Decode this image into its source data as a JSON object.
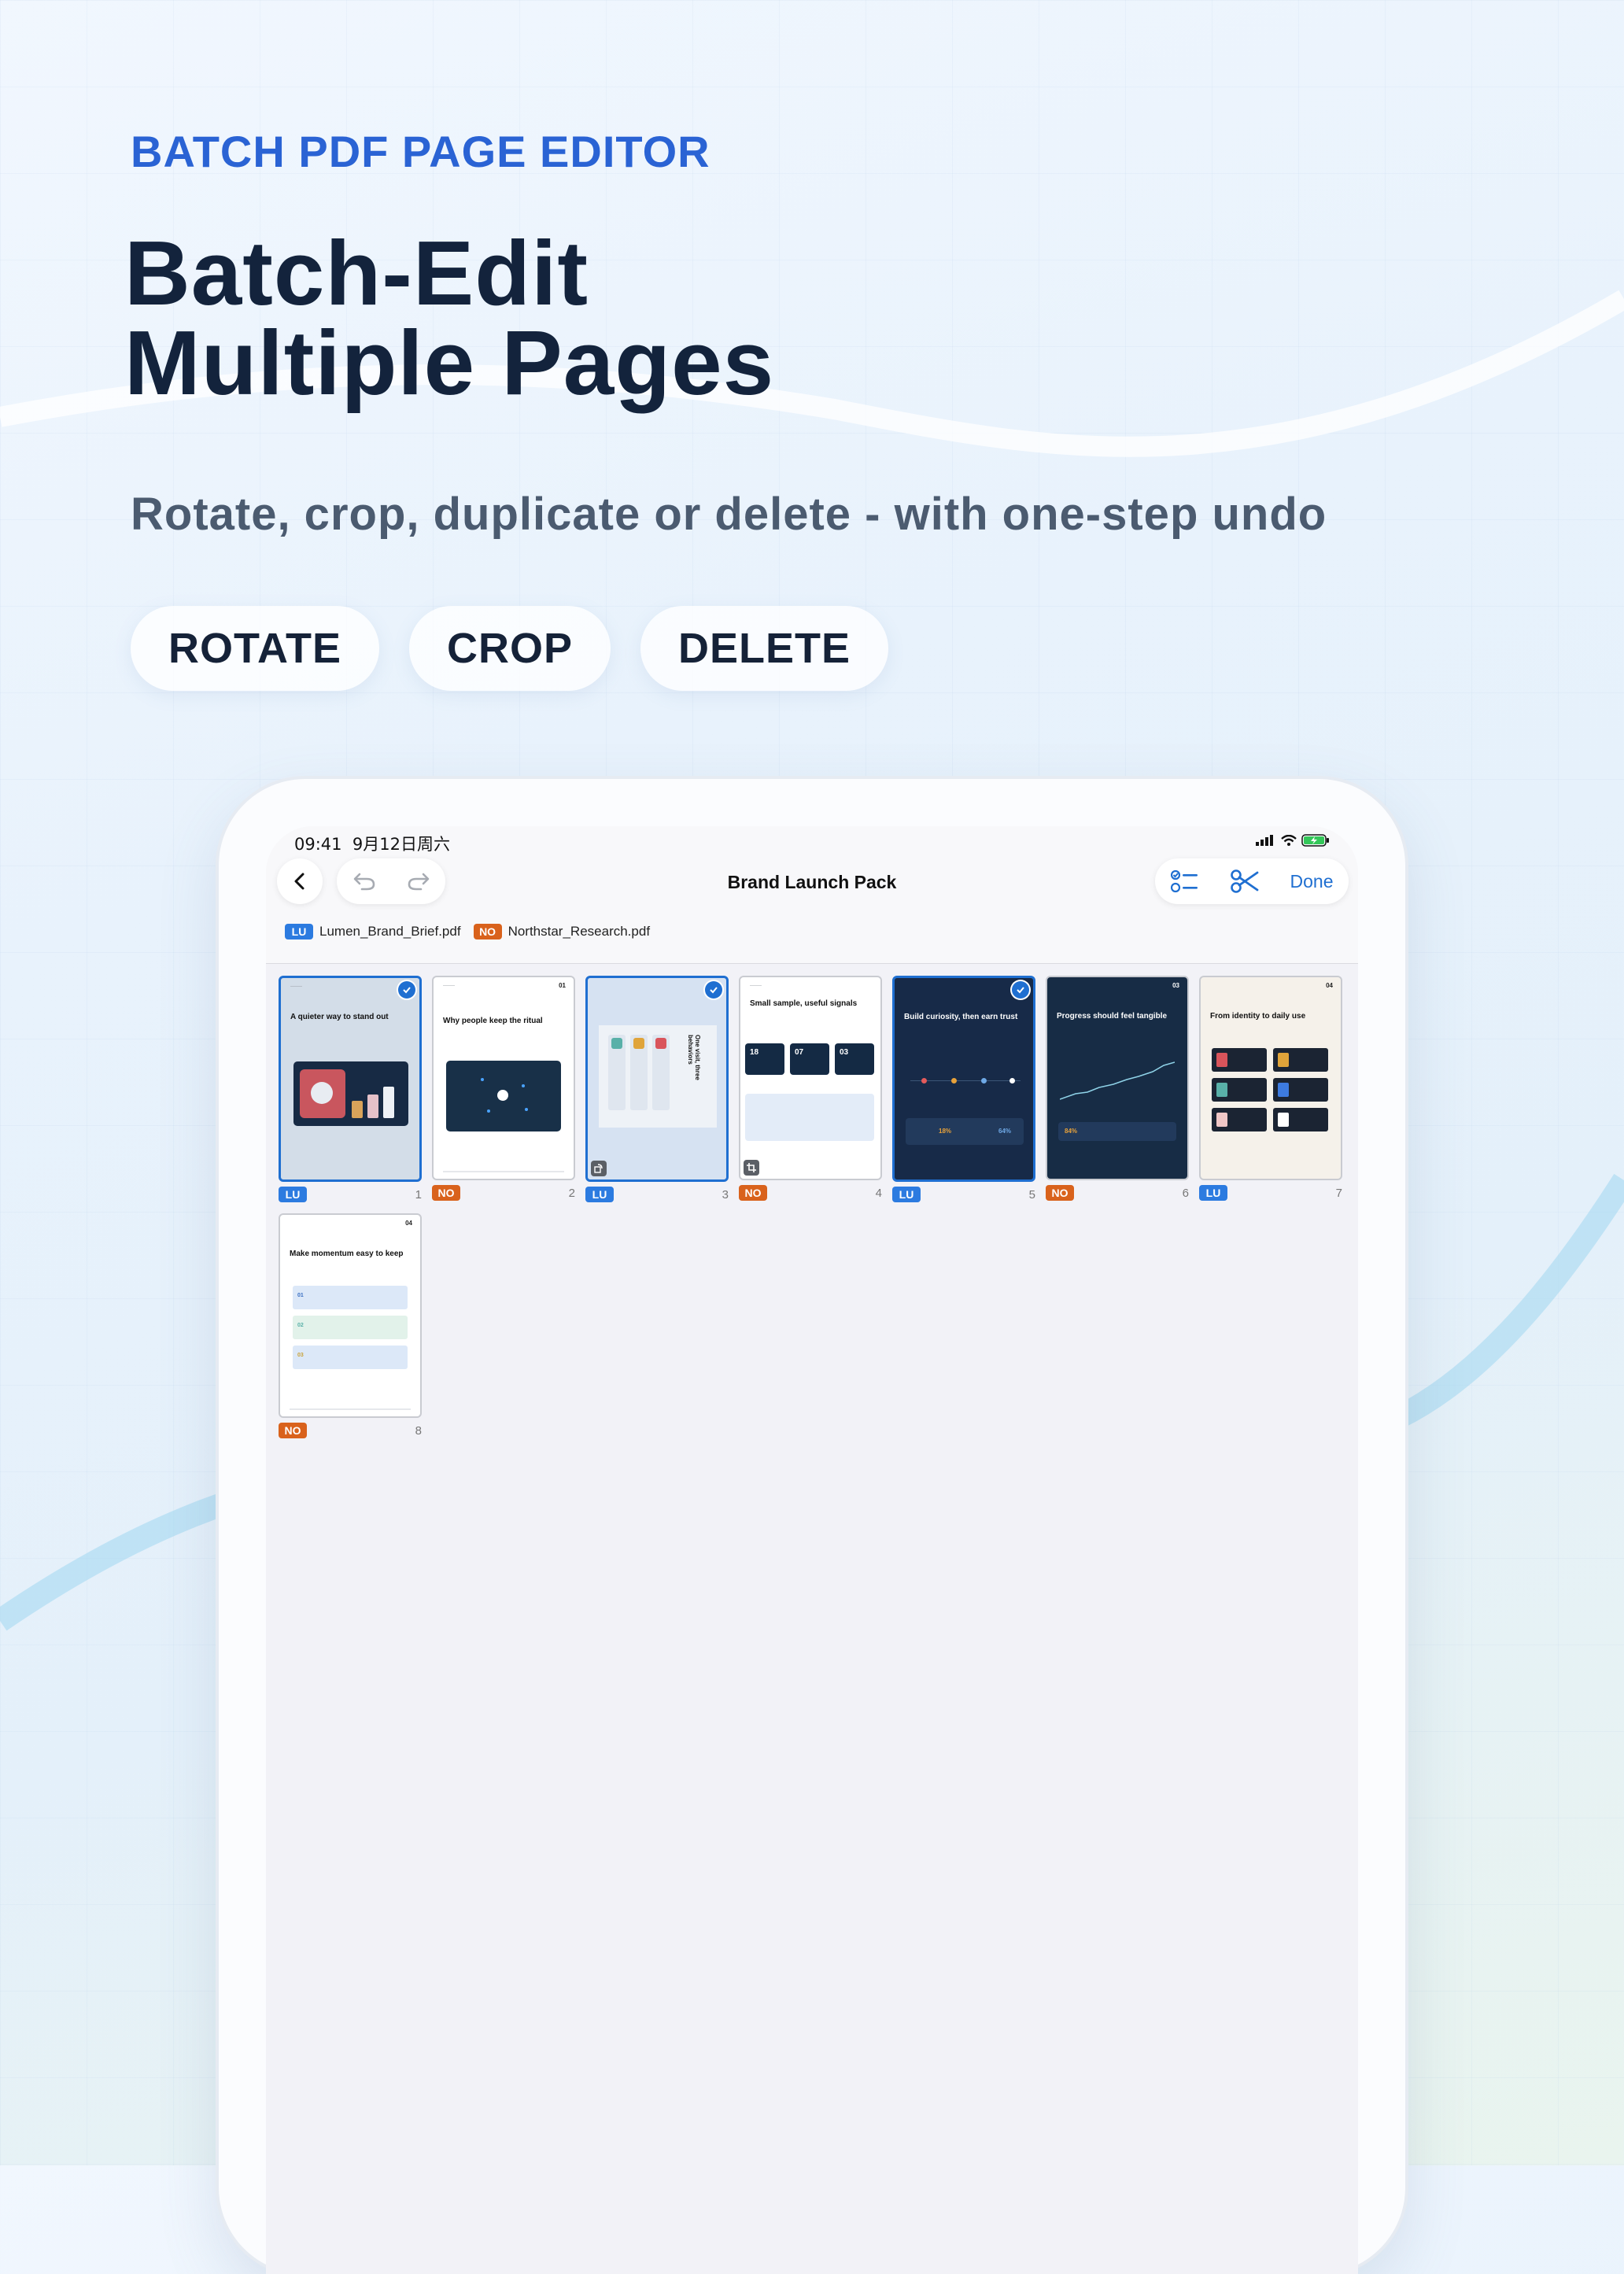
{
  "hero": {
    "eyebrow": "BATCH PDF PAGE EDITOR",
    "headline_line1": "Batch-Edit",
    "headline_line2": "Multiple Pages",
    "subtitle": "Rotate, crop, duplicate or delete - with one-step undo",
    "chips": [
      "ROTATE",
      "CROP",
      "DELETE"
    ]
  },
  "status_bar": {
    "time": "09:41",
    "date": "9月12日周六"
  },
  "toolbar": {
    "title": "Brand Launch Pack",
    "done_label": "Done"
  },
  "files": [
    {
      "tag": "LU",
      "name": "Lumen_Brand_Brief.pdf"
    },
    {
      "tag": "NO",
      "name": "Northstar_Research.pdf"
    }
  ],
  "pages": [
    {
      "num": "1",
      "tag": "LU",
      "selected": true,
      "title": "A quieter way to stand out"
    },
    {
      "num": "2",
      "tag": "NO",
      "selected": false,
      "title": "Why people keep the ritual",
      "page_no": "01"
    },
    {
      "num": "3",
      "tag": "LU",
      "selected": true,
      "title": "One visit, three behaviors",
      "op": "rotate"
    },
    {
      "num": "4",
      "tag": "NO",
      "selected": false,
      "title": "Small sample, useful signals",
      "stats": [
        "18",
        "07",
        "03"
      ],
      "op": "crop"
    },
    {
      "num": "5",
      "tag": "LU",
      "selected": true,
      "title": "Build curiosity, then earn trust",
      "values": [
        "18%",
        "64%"
      ]
    },
    {
      "num": "6",
      "tag": "NO",
      "selected": false,
      "title": "Progress should feel tangible",
      "page_no": "03",
      "value": "84%"
    },
    {
      "num": "7",
      "tag": "LU",
      "selected": false,
      "title": "From identity to daily use",
      "page_no": "04"
    },
    {
      "num": "8",
      "tag": "NO",
      "selected": false,
      "title": "Make momentum easy to keep",
      "page_no": "04",
      "steps": [
        "01",
        "02",
        "03"
      ]
    }
  ],
  "colors": {
    "accent": "#1f6fd1",
    "tag_lu": "#2c7be0",
    "tag_no": "#d9621c",
    "headline": "#13233c",
    "eyebrow": "#2a63d4"
  }
}
